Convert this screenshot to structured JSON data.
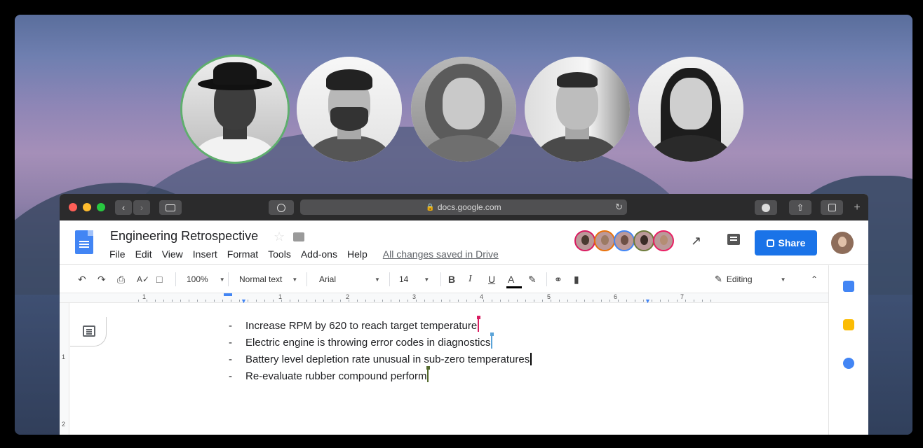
{
  "call": {
    "participants": [
      {
        "name": "participant-1",
        "active": true
      },
      {
        "name": "participant-2",
        "active": false
      },
      {
        "name": "participant-3",
        "active": false
      },
      {
        "name": "participant-4",
        "active": false
      },
      {
        "name": "participant-5",
        "active": false
      }
    ]
  },
  "browser": {
    "url": "docs.google.com"
  },
  "doc": {
    "title": "Engineering Retrospective",
    "menu": [
      "File",
      "Edit",
      "View",
      "Insert",
      "Format",
      "Tools",
      "Add-ons",
      "Help"
    ],
    "save_status": "All changes saved in Drive",
    "share_label": "Share",
    "collaborator_colors": [
      "#d81b60",
      "#e8710a",
      "#4285f4",
      "#6d7a3a",
      "#e91e63"
    ]
  },
  "toolbar": {
    "zoom": "100%",
    "style": "Normal text",
    "font": "Arial",
    "size": "14",
    "bold": "B",
    "italic": "I",
    "underline": "U",
    "text_color": "A",
    "mode": "Editing"
  },
  "ruler": {
    "marks": [
      "1",
      "1",
      "2",
      "3",
      "4",
      "5",
      "6",
      "7"
    ],
    "left_marks": [
      "1",
      "2"
    ]
  },
  "content": {
    "bullet_marker": "-",
    "bullets": [
      {
        "text": "Increase RPM by 620 to reach target temperature",
        "cursor_color": "#d81b60"
      },
      {
        "text": "Electric engine is throwing error codes in diagnostics",
        "cursor_color": "#5aa3d8"
      },
      {
        "text": "Battery level depletion rate unusual in sub-zero temperatures",
        "cursor_color": "#000000"
      },
      {
        "text": "Re-evaluate rubber compound perform",
        "cursor_color": "#556b2f"
      }
    ]
  }
}
